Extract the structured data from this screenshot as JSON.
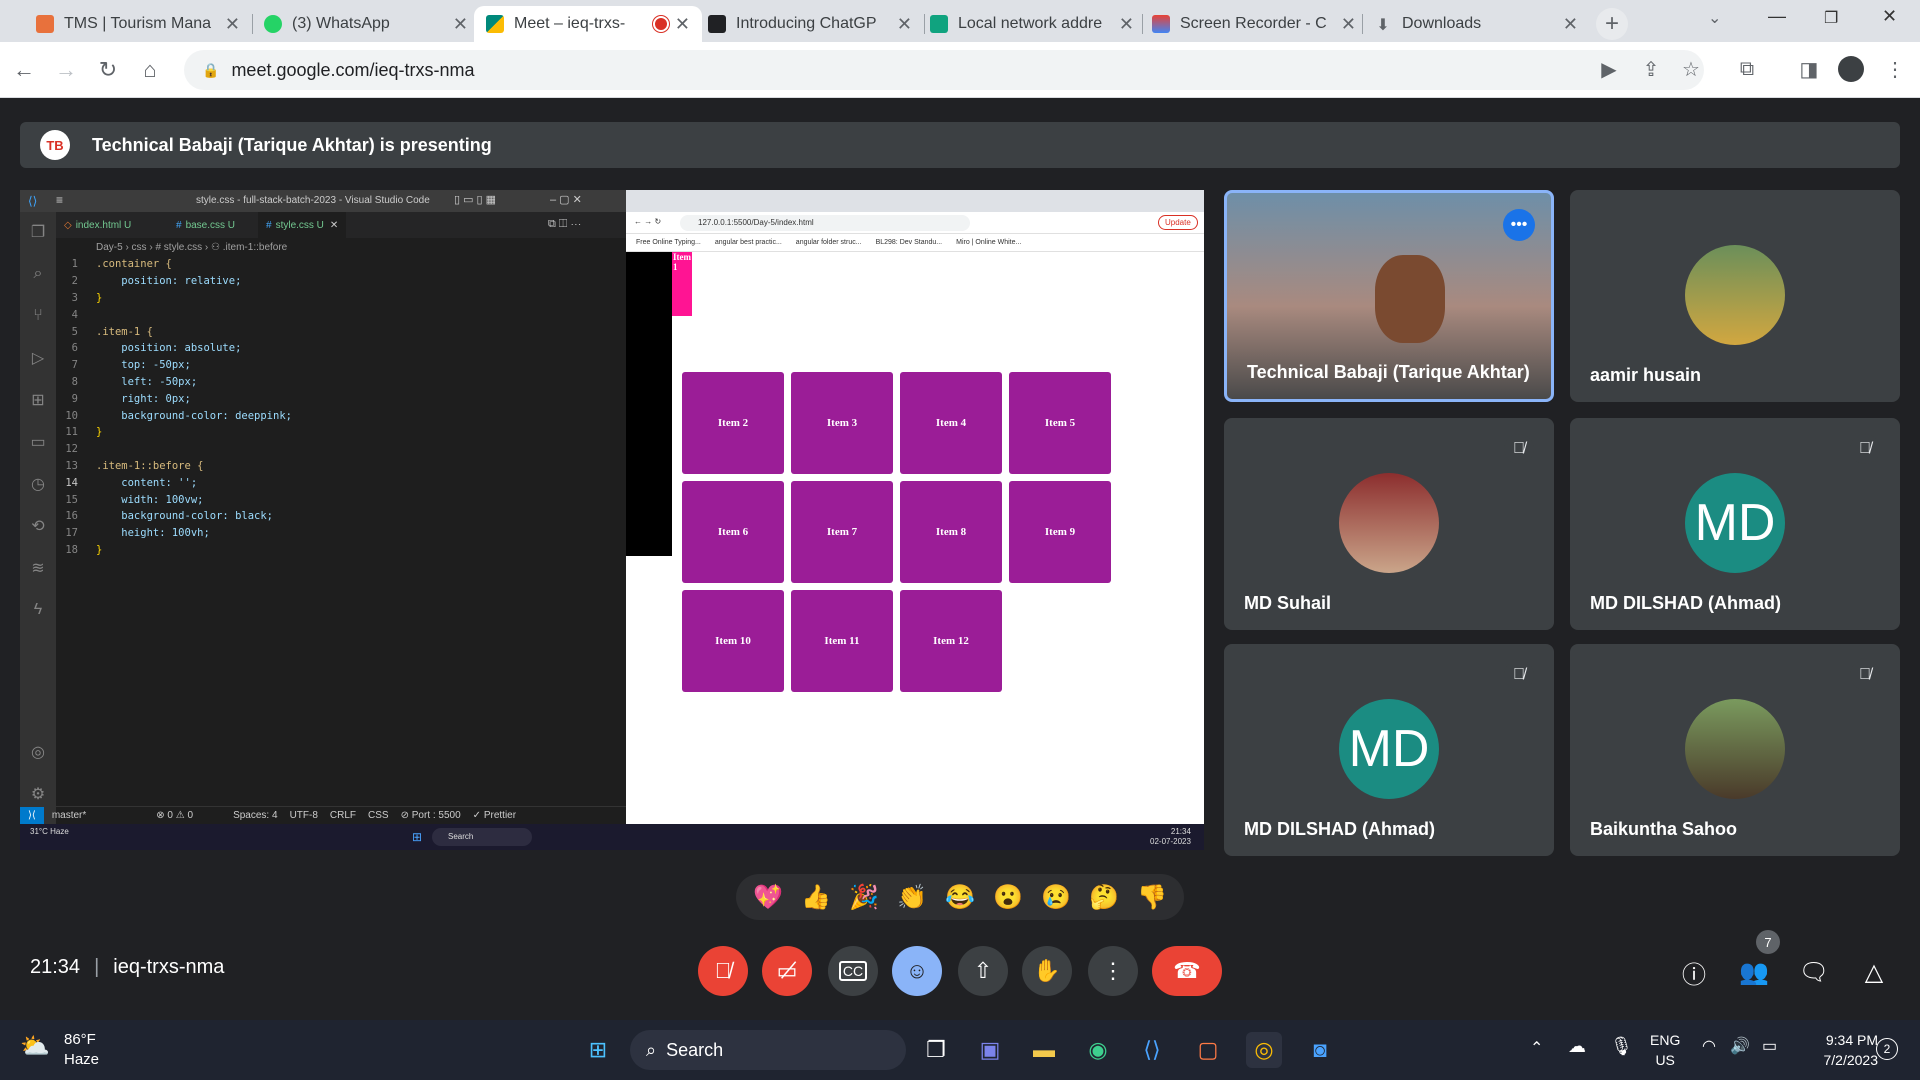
{
  "browser": {
    "tabs": [
      {
        "title": "TMS | Tourism Mana",
        "color": "#e8713c"
      },
      {
        "title": "(3) WhatsApp",
        "color": "#25d366"
      },
      {
        "title": "Meet – ieq-trxs-",
        "color": "#00897b"
      },
      {
        "title": "Introducing ChatGP",
        "color": "#202124"
      },
      {
        "title": "Local network addre",
        "color": "#10a37f"
      },
      {
        "title": "Screen Recorder - C",
        "color": "#e94235"
      },
      {
        "title": "Downloads",
        "color": "#5f6368"
      }
    ],
    "url": "meet.google.com/ieq-trxs-nma"
  },
  "presenting": "Technical Babaji (Tarique Akhtar) is presenting",
  "presenter_logo": "TB",
  "vscode": {
    "title": "style.css - full-stack-batch-2023 - Visual Studio Code",
    "tabs": [
      "index.html U",
      "base.css U",
      "style.css U"
    ],
    "breadcrumb": "Day-5 › css › # style.css › ⚇ .item-1::before",
    "status": {
      "branch": "master*",
      "problems": "⊗ 0 ⚠ 0",
      "spaces": "Spaces: 4",
      "encoding": "UTF-8",
      "eol": "CRLF",
      "lang": "CSS",
      "port": "⊘ Port : 5500",
      "prettier": "✓ Prettier"
    },
    "lines": [
      {
        "n": "1",
        "t": ".container {"
      },
      {
        "n": "2",
        "t": "    position: relative;"
      },
      {
        "n": "3",
        "t": "}"
      },
      {
        "n": "4",
        "t": ""
      },
      {
        "n": "5",
        "t": ".item-1 {"
      },
      {
        "n": "6",
        "t": "    position: absolute;"
      },
      {
        "n": "7",
        "t": "    top: -50px;"
      },
      {
        "n": "8",
        "t": "    left: -50px;"
      },
      {
        "n": "9",
        "t": "    right: 0px;"
      },
      {
        "n": "10",
        "t": "    background-color: deeppink;"
      },
      {
        "n": "11",
        "t": "}"
      },
      {
        "n": "12",
        "t": ""
      },
      {
        "n": "13",
        "t": ".item-1::before {"
      },
      {
        "n": "14",
        "t": "    content: '';"
      },
      {
        "n": "15",
        "t": "    width: 100vw;"
      },
      {
        "n": "16",
        "t": "    background-color: black;"
      },
      {
        "n": "17",
        "t": "    height: 100vh;"
      },
      {
        "n": "18",
        "t": "}"
      }
    ]
  },
  "inner_browser": {
    "url": "127.0.0.1:5500/Day-5/index.html",
    "update_label": "Update",
    "bookmarks": [
      "Free Online Typing...",
      "angular best practic...",
      "angular folder struc...",
      "BL298: Dev Standu...",
      "Miro | Online White..."
    ],
    "item1_label": "Item 1",
    "items": [
      "Item 2",
      "Item 3",
      "Item 4",
      "Item 5",
      "Item 6",
      "Item 7",
      "Item 8",
      "Item 9",
      "Item 10",
      "Item 11",
      "Item 12"
    ],
    "taskbar_weather": "31°C Haze",
    "taskbar_search": "Search",
    "taskbar_time": "21:34",
    "taskbar_date": "02-07-2023"
  },
  "participants": [
    {
      "name": "Technical Babaji (Tarique Akhtar)",
      "muted": false,
      "type": "video"
    },
    {
      "name": "aamir husain",
      "muted": false,
      "type": "photo"
    },
    {
      "name": "MD Suhail",
      "muted": true,
      "type": "photo"
    },
    {
      "name": "MD DILSHAD (Ahmad)",
      "muted": true,
      "type": "initials",
      "initials": "MD"
    },
    {
      "name": "MD DILSHAD (Ahmad)",
      "muted": true,
      "type": "initials",
      "initials": "MD"
    },
    {
      "name": "Baikuntha Sahoo",
      "muted": true,
      "type": "photo"
    }
  ],
  "reactions": [
    "💖",
    "👍",
    "🎉",
    "👏",
    "😂",
    "😮",
    "😢",
    "🤔",
    "👎"
  ],
  "meeting": {
    "time": "21:34",
    "code": "ieq-trxs-nma",
    "people_count": "7"
  },
  "taskbar": {
    "weather_temp": "86°F",
    "weather_desc": "Haze",
    "search": "Search",
    "lang1": "ENG",
    "lang2": "US",
    "time": "9:34 PM",
    "date": "7/2/2023",
    "notif": "2"
  }
}
